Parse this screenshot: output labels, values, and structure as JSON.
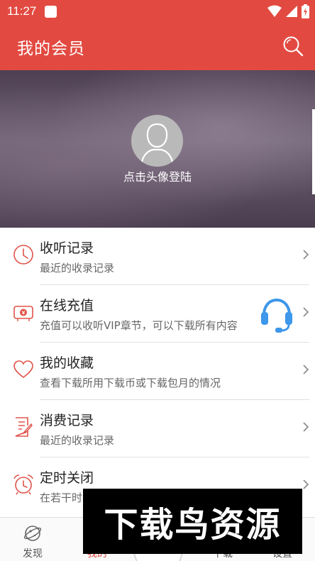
{
  "status_bar": {
    "time": "11:27"
  },
  "app_bar": {
    "title": "我的会员",
    "search_icon": "search-icon"
  },
  "hero": {
    "login_text": "点击头像登陆",
    "avatar_icon": "user-avatar-icon"
  },
  "menu_items": [
    {
      "icon": "clock-icon",
      "title": "收听记录",
      "subtitle": "最近的收录记录"
    },
    {
      "icon": "recharge-icon",
      "title": "在线充值",
      "subtitle": "充值可以收听VIP章节，可以下载所有内容"
    },
    {
      "icon": "heart-icon",
      "title": "我的收藏",
      "subtitle": "查看下载所用下载币或下载包月的情况"
    },
    {
      "icon": "document-edit-icon",
      "title": "消费记录",
      "subtitle": "最近的收录记录"
    },
    {
      "icon": "alarm-clock-icon",
      "title": "定时关闭",
      "subtitle": "在若干时"
    }
  ],
  "bottom_nav": [
    {
      "label": "发现",
      "icon": "planet-icon"
    },
    {
      "label": "我的",
      "active": true
    },
    {
      "label": "下载"
    },
    {
      "label": "设置"
    }
  ],
  "watermark": {
    "text": "下载鸟资源"
  },
  "colors": {
    "accent": "#e24a41",
    "icon_red": "#e0534a",
    "headset_blue": "#3d97ea"
  }
}
